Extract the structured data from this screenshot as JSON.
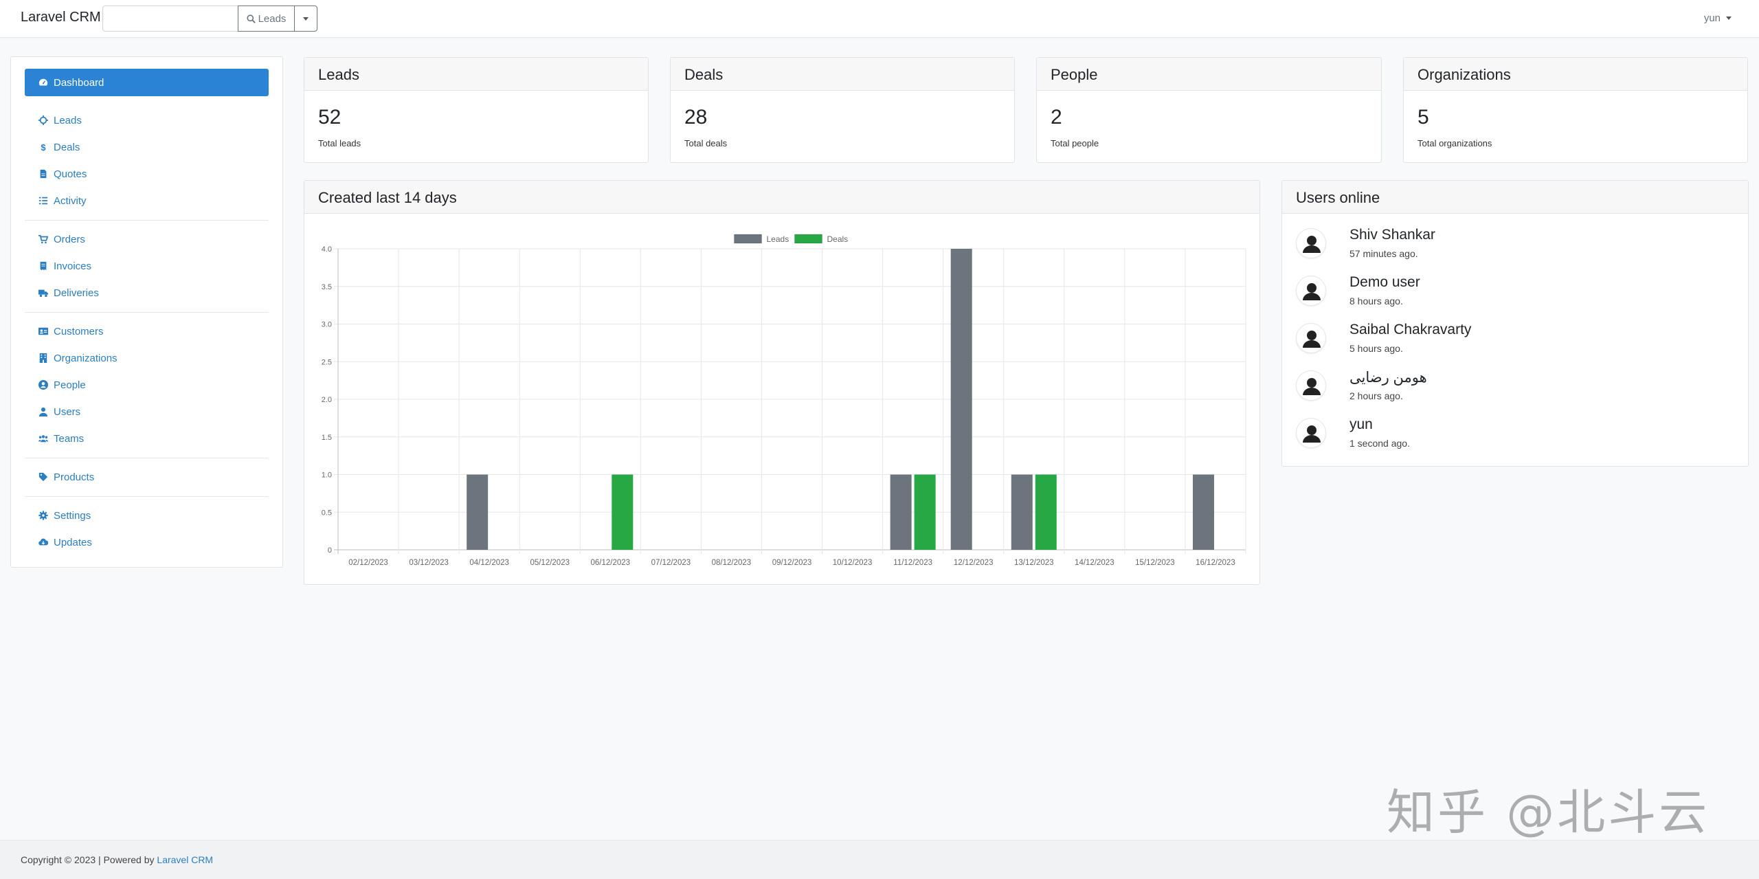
{
  "navbar": {
    "brand": "Laravel CRM",
    "search_value": "",
    "search_button_label": "Leads",
    "user": "yun"
  },
  "sidebar": {
    "items": [
      {
        "label": "Dashboard",
        "icon": "tachometer-icon",
        "active": true
      },
      {
        "label": "Leads",
        "icon": "crosshairs-icon"
      },
      {
        "label": "Deals",
        "icon": "dollar-icon"
      },
      {
        "label": "Quotes",
        "icon": "file-icon"
      },
      {
        "label": "Activity",
        "icon": "list-icon"
      },
      {
        "label": "Orders",
        "icon": "cart-icon"
      },
      {
        "label": "Invoices",
        "icon": "receipt-icon"
      },
      {
        "label": "Deliveries",
        "icon": "truck-icon"
      },
      {
        "label": "Customers",
        "icon": "id-card-icon"
      },
      {
        "label": "Organizations",
        "icon": "building-icon"
      },
      {
        "label": "People",
        "icon": "user-circle-icon"
      },
      {
        "label": "Users",
        "icon": "user-icon"
      },
      {
        "label": "Teams",
        "icon": "users-icon"
      },
      {
        "label": "Products",
        "icon": "tag-icon"
      },
      {
        "label": "Settings",
        "icon": "gear-icon"
      },
      {
        "label": "Updates",
        "icon": "cloud-download-icon"
      }
    ]
  },
  "stats": [
    {
      "title": "Leads",
      "value": "52",
      "label": "Total leads"
    },
    {
      "title": "Deals",
      "value": "28",
      "label": "Total deals"
    },
    {
      "title": "People",
      "value": "2",
      "label": "Total people"
    },
    {
      "title": "Organizations",
      "value": "5",
      "label": "Total organizations"
    }
  ],
  "chart_panel": {
    "title": "Created last 14 days"
  },
  "chart_data": {
    "type": "bar",
    "categories": [
      "02/12/2023",
      "03/12/2023",
      "04/12/2023",
      "05/12/2023",
      "06/12/2023",
      "07/12/2023",
      "08/12/2023",
      "09/12/2023",
      "10/12/2023",
      "11/12/2023",
      "12/12/2023",
      "13/12/2023",
      "14/12/2023",
      "15/12/2023",
      "16/12/2023"
    ],
    "series": [
      {
        "name": "Leads",
        "color": "#6c757d",
        "values": [
          0,
          0,
          1,
          0,
          0,
          0,
          0,
          0,
          0,
          1,
          4,
          1,
          0,
          0,
          1
        ]
      },
      {
        "name": "Deals",
        "color": "#28a745",
        "values": [
          0,
          0,
          0,
          0,
          1,
          0,
          0,
          0,
          0,
          1,
          0,
          1,
          0,
          0,
          0
        ]
      }
    ],
    "ylim": [
      0,
      4
    ],
    "yticks": [
      "0",
      "0.5",
      "1.0",
      "1.5",
      "2.0",
      "2.5",
      "3.0",
      "3.5",
      "4.0"
    ],
    "legend": "top-center",
    "grid": true
  },
  "users_online": {
    "title": "Users online",
    "users": [
      {
        "name": "Shiv Shankar",
        "time": "57 minutes ago."
      },
      {
        "name": "Demo user",
        "time": "8 hours ago."
      },
      {
        "name": "Saibal Chakravarty",
        "time": "5 hours ago."
      },
      {
        "name": "هومن رضایی",
        "time": "2 hours ago."
      },
      {
        "name": "yun",
        "time": "1 second ago."
      }
    ]
  },
  "footer": {
    "text": "Copyright © 2023 | Powered by",
    "link": "Laravel CRM"
  },
  "watermark": "知乎 @北斗云"
}
